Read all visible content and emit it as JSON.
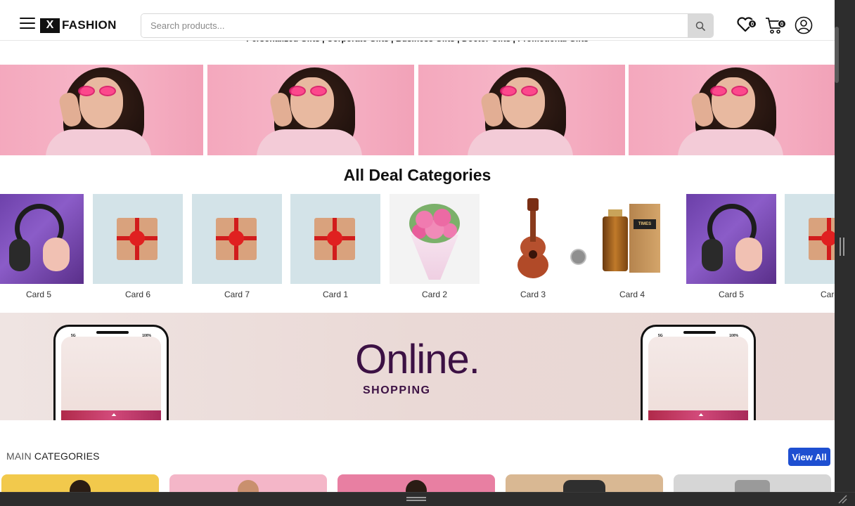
{
  "header": {
    "logo_mark": "X",
    "logo_text": "FASHION",
    "search_placeholder": "Search products...",
    "wishlist_count": "0",
    "cart_count": "0"
  },
  "tagline": "Personalized Gifts | Corporate Gifts | Business Gifts | Doctor Gifts | Promotional Gifts",
  "deals": {
    "title": "All Deal Categories",
    "cards": [
      {
        "label": "Card 5",
        "image": "headphones"
      },
      {
        "label": "Card 6",
        "image": "gift-box"
      },
      {
        "label": "Card 7",
        "image": "gift-box"
      },
      {
        "label": "Card 1",
        "image": "gift-box"
      },
      {
        "label": "Card 2",
        "image": "flower-bouquet"
      },
      {
        "label": "Card 3",
        "image": "ukulele"
      },
      {
        "label": "Card 4",
        "image": "perfume"
      },
      {
        "label": "Card 5",
        "image": "headphones"
      },
      {
        "label": "Card",
        "image": "gift-box"
      }
    ]
  },
  "promo": {
    "title": "Online.",
    "subtitle": "SHOPPING",
    "phone_status_left": "5G",
    "phone_status_right": "100%"
  },
  "main_categories": {
    "title_light": "MAIN",
    "title_bold": "CATEGORIES",
    "view_all_label": "View All"
  },
  "colors": {
    "accent_blue": "#1e4fd1",
    "hero_pink": "#f6b6c8",
    "promo_text": "#3c1144"
  }
}
